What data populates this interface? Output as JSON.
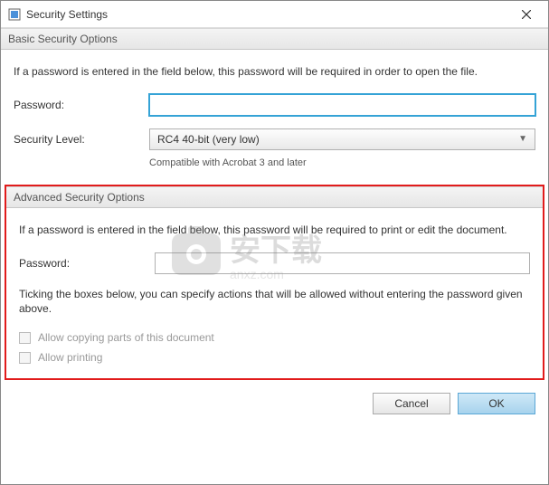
{
  "window": {
    "title": "Security Settings"
  },
  "basic": {
    "header": "Basic Security Options",
    "desc": "If a password is entered in the field below, this password will be required in order to open the file.",
    "password_label": "Password:",
    "password_value": "",
    "level_label": "Security Level:",
    "level_value": "RC4 40-bit (very low)",
    "level_hint": "Compatible with Acrobat 3 and later"
  },
  "advanced": {
    "header": "Advanced Security Options",
    "desc": "If a password is entered in the field below, this password will be required to print or edit the document.",
    "password_label": "Password:",
    "password_value": "",
    "tick_desc": "Ticking the boxes below, you can specify actions that will be allowed without entering the password given above.",
    "allow_copy_label": "Allow copying parts of this document",
    "allow_print_label": "Allow printing"
  },
  "buttons": {
    "cancel": "Cancel",
    "ok": "OK"
  },
  "watermark": {
    "text": "安下载",
    "sub": "anxz.com"
  }
}
